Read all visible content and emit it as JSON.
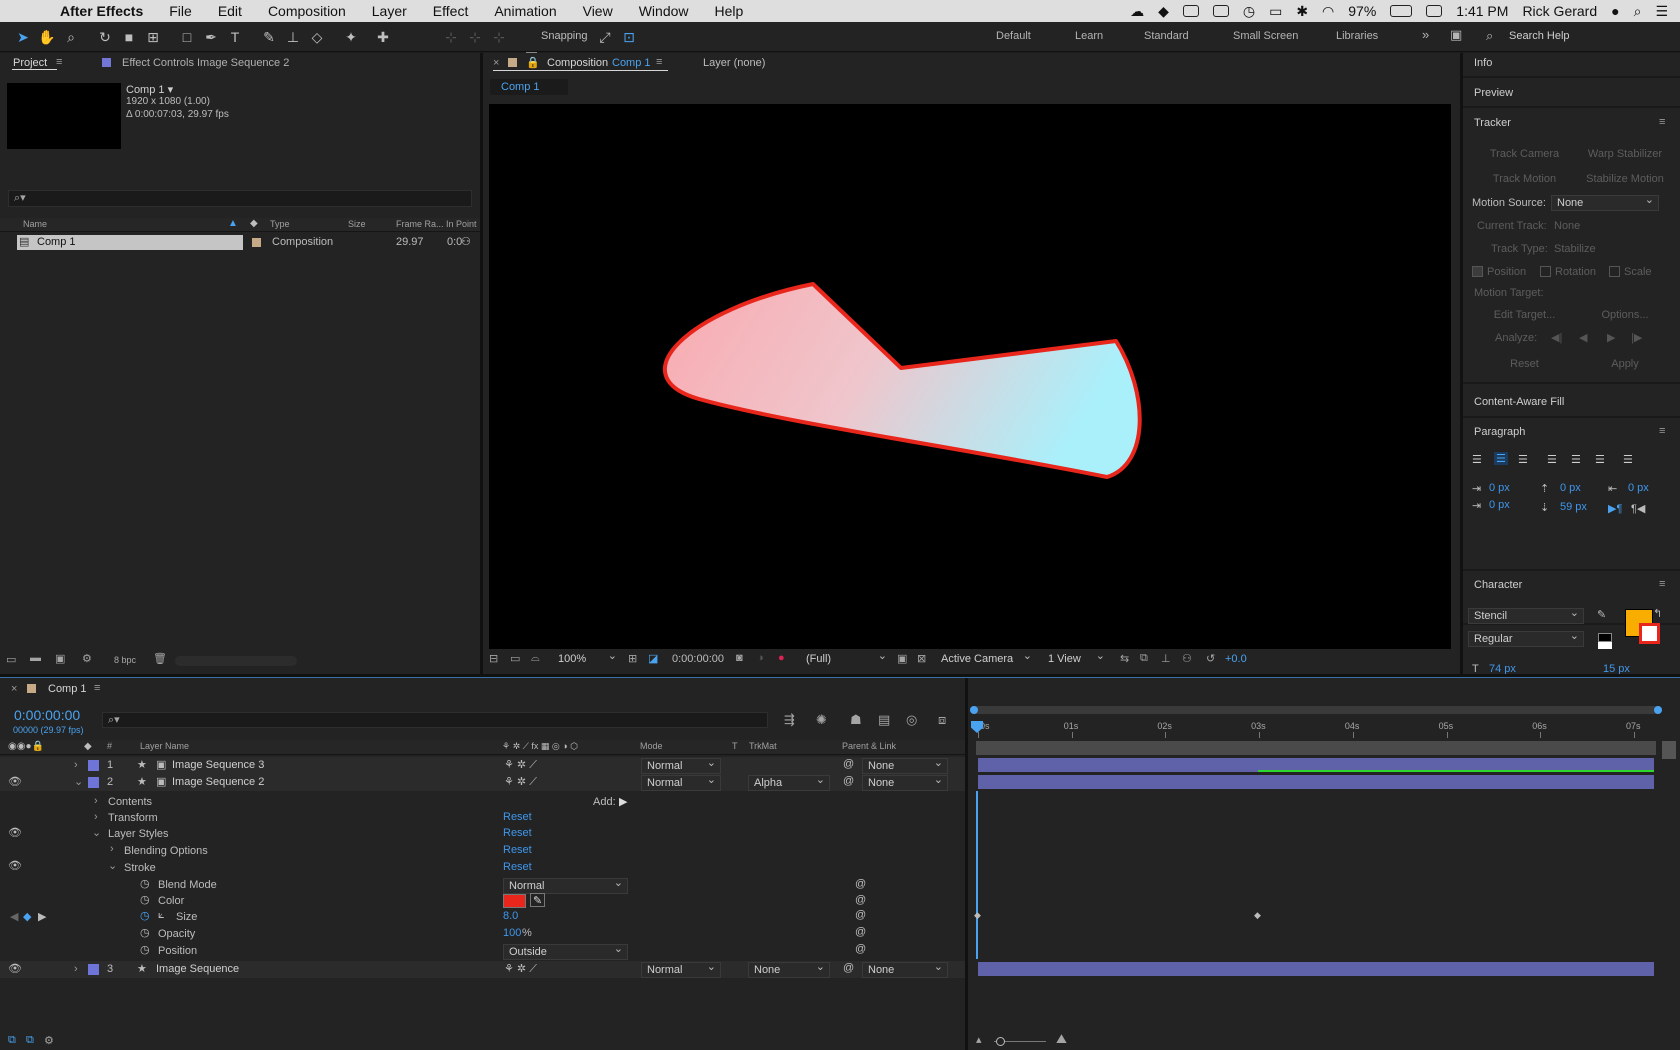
{
  "menubar": {
    "app": "After Effects",
    "items": [
      "File",
      "Edit",
      "Composition",
      "Layer",
      "Effect",
      "Animation",
      "View",
      "Window",
      "Help"
    ],
    "battery": "97%",
    "time": "1:41 PM",
    "user": "Rick Gerard"
  },
  "toolbar": {
    "snapping": "Snapping",
    "workspaces": [
      "Default",
      "Learn",
      "Standard",
      "Small Screen",
      "Libraries"
    ],
    "search_placeholder": "Search Help"
  },
  "project": {
    "tab": "Project",
    "effect_tab": "Effect Controls Image Sequence 2",
    "item_name": "Comp 1 ▾",
    "item_size": "1920 x 1080 (1.00)",
    "item_duration": "Δ 0:00:07:03, 29.97 fps",
    "columns": [
      "Name",
      "Type",
      "Size",
      "Frame Ra...",
      "In Point"
    ],
    "row": {
      "name": "Comp 1",
      "type": "Composition",
      "fps": "29.97",
      "in": "0:0"
    },
    "bpc": "8 bpc"
  },
  "composition": {
    "tab_label": "Composition",
    "tab_comp": "Comp 1",
    "layer_tab": "Layer (none)",
    "breadcrumb": "Comp 1",
    "zoom": "100%",
    "timecode": "0:00:00:00",
    "resolution": "(Full)",
    "camera": "Active Camera",
    "views": "1 View",
    "exposure": "+0.0"
  },
  "right": {
    "info": "Info",
    "preview": "Preview",
    "tracker": "Tracker",
    "track_camera": "Track Camera",
    "warp_stabilizer": "Warp Stabilizer",
    "track_motion": "Track Motion",
    "stabilize_motion": "Stabilize Motion",
    "motion_source_label": "Motion Source:",
    "motion_source": "None",
    "current_track_label": "Current Track:",
    "current_track": "None",
    "track_type_label": "Track Type:",
    "track_type": "Stabilize",
    "position": "Position",
    "rotation": "Rotation",
    "scale": "Scale",
    "motion_target": "Motion Target:",
    "edit_target": "Edit Target...",
    "options": "Options...",
    "analyze": "Analyze:",
    "reset": "Reset",
    "apply": "Apply",
    "content_aware": "Content-Aware Fill",
    "paragraph": "Paragraph",
    "para_vals": [
      "0 px",
      "0 px",
      "0 px",
      "0 px",
      "59 px"
    ],
    "character": "Character",
    "font": "Stencil",
    "style": "Regular",
    "font_size": "74 px",
    "leading": "15 px",
    "fill_color": "#f9ad00"
  },
  "timeline": {
    "tab": "Comp 1",
    "timecode": "0:00:00:00",
    "frames": "00000 (29.97 fps)",
    "headers": {
      "num": "#",
      "name": "Layer Name",
      "mode": "Mode",
      "t": "T",
      "trkmat": "TrkMat",
      "parent": "Parent & Link"
    },
    "ruler": [
      "0s",
      "01s",
      "02s",
      "03s",
      "04s",
      "05s",
      "06s",
      "07s"
    ],
    "layers": [
      {
        "num": "1",
        "name": "Image Sequence 3",
        "mode": "Normal",
        "trkmat": "",
        "parent": "None"
      },
      {
        "num": "2",
        "name": "Image Sequence 2",
        "mode": "Normal",
        "trkmat": "Alpha",
        "parent": "None"
      },
      {
        "num": "3",
        "name": "Image Sequence",
        "mode": "Normal",
        "trkmat": "None",
        "parent": "None"
      }
    ],
    "props": {
      "contents": "Contents",
      "add": "Add:",
      "transform": "Transform",
      "layer_styles": "Layer Styles",
      "blending": "Blending Options",
      "stroke": "Stroke",
      "blend_mode": "Blend Mode",
      "blend_value": "Normal",
      "color": "Color",
      "size": "Size",
      "size_value": "8.0",
      "opacity": "Opacity",
      "opacity_value": "100",
      "opacity_unit": "%",
      "position": "Position",
      "position_value": "Outside",
      "reset": "Reset"
    },
    "stroke_color": "#e8261b"
  }
}
